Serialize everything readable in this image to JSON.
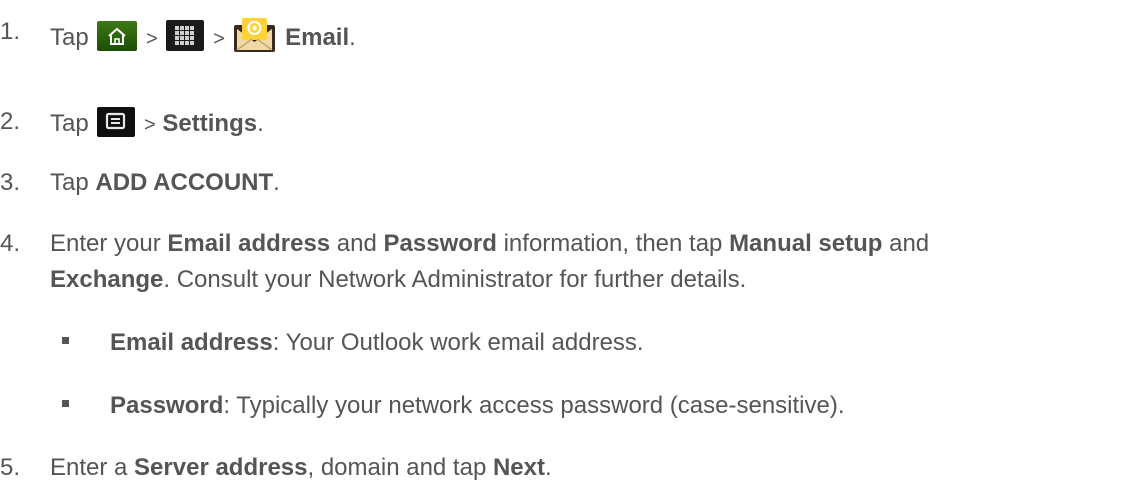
{
  "steps": [
    {
      "number": "1.",
      "tap": "Tap",
      "sep1": ">",
      "sep2": ">",
      "email": "Email",
      "end": "."
    },
    {
      "number": "2.",
      "tap": "Tap",
      "sep": ">",
      "settings": "Settings",
      "end": "."
    },
    {
      "number": "3.",
      "tap": "Tap",
      "add_account": "ADD ACCOUNT",
      "end": "."
    },
    {
      "number": "4.",
      "a": "Enter your ",
      "b1": "Email address",
      "a2": " and ",
      "b2": "Password",
      "a3": " information, then tap ",
      "b3": "Manual setup",
      "a4": " and",
      "b4": "Exchange",
      "a5": ". Consult your Network Administrator for further details."
    },
    {
      "number": "5.",
      "a": "Enter a ",
      "b1": "Server address",
      "a2": ", domain and tap ",
      "b2": "Next",
      "end": "."
    }
  ],
  "sub_items": [
    {
      "label": "Email address",
      "text": ": Your Outlook work email address."
    },
    {
      "label": "Password",
      "text": ": Typically your network access password (case-sensitive)."
    }
  ],
  "icons": [
    "home-icon",
    "apps-grid-icon",
    "email-app-icon",
    "menu-icon"
  ],
  "colors": {
    "text": "#555555",
    "home_icon_bg": "#2f6b0f",
    "dark_icon_bg": "#111111"
  }
}
